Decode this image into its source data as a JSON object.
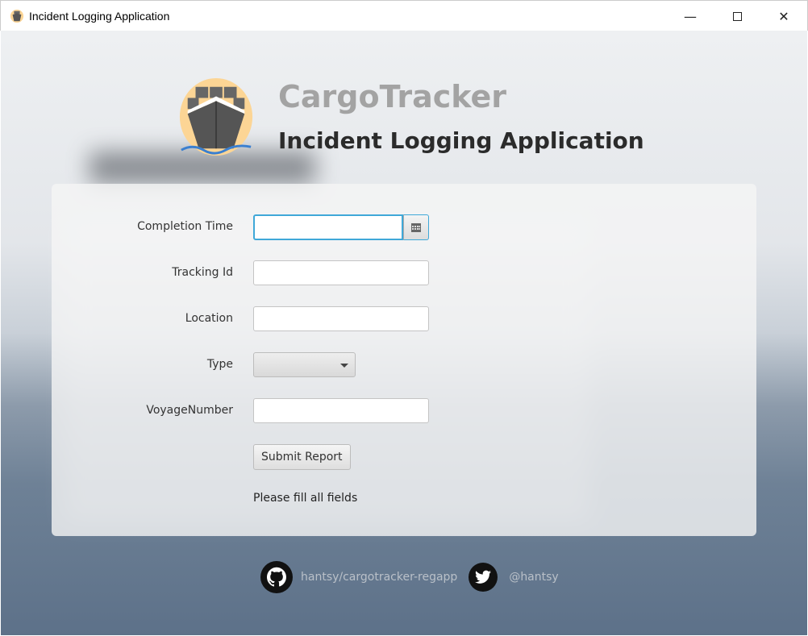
{
  "window": {
    "title": "Incident Logging Application"
  },
  "header": {
    "brand": "CargoTracker",
    "subtitle": "Incident Logging Application"
  },
  "form": {
    "completion_time": {
      "label": "Completion Time",
      "value": ""
    },
    "tracking_id": {
      "label": "Tracking Id",
      "value": ""
    },
    "location": {
      "label": "Location",
      "value": ""
    },
    "type": {
      "label": "Type",
      "value": ""
    },
    "voyage_number": {
      "label": "VoyageNumber",
      "value": ""
    },
    "submit_label": "Submit Report",
    "status": "Please fill all fields"
  },
  "footer": {
    "github": "hantsy/cargotracker-regapp",
    "twitter": "@hantsy"
  }
}
